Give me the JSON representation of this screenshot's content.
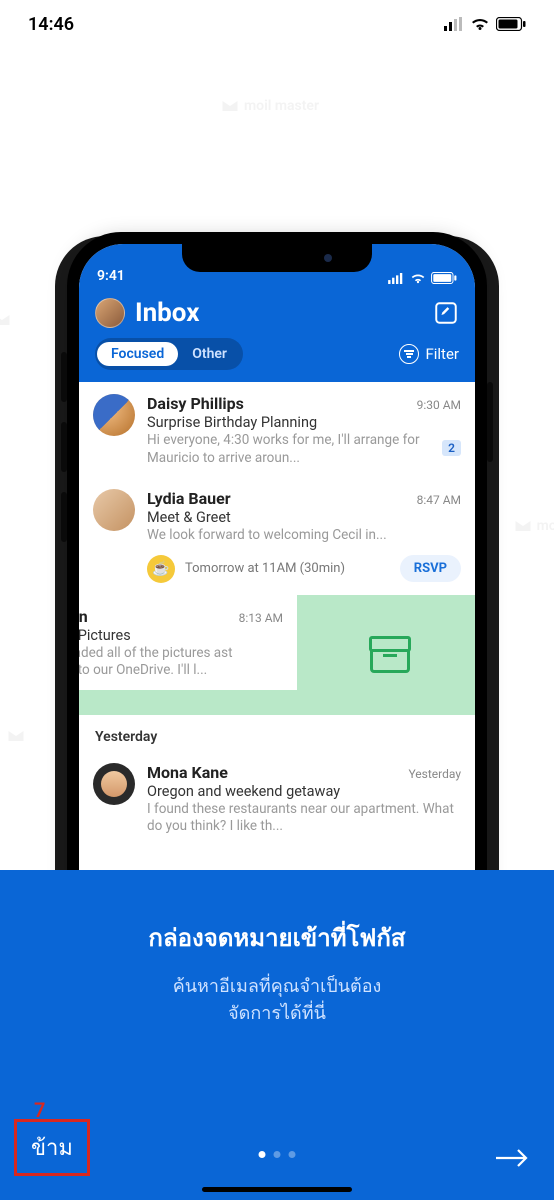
{
  "outer_status": {
    "time": "14:46"
  },
  "phone": {
    "status_time": "9:41",
    "title": "Inbox",
    "tabs": {
      "focused": "Focused",
      "other": "Other"
    },
    "filter_label": "Filter",
    "messages": [
      {
        "sender": "Daisy Phillips",
        "time": "9:30 AM",
        "subject": "Surprise Birthday Planning",
        "preview": "Hi everyone, 4:30 works for me, I'll arrange for Mauricio to arrive aroun...",
        "badge": "2"
      },
      {
        "sender": "Lydia Bauer",
        "time": "8:47 AM",
        "subject": "Meet & Greet",
        "preview": "We look forward to welcoming Cecil in...",
        "event_text": "Tomorrow at 11AM (30min)",
        "rsvp": "RSVP"
      },
      {
        "sender": "te Burton",
        "time": "8:13 AM",
        "subject": "Bonding Pictures",
        "preview": "cil, I uploaded all of the pictures ast weekend to our OneDrive. I'll l..."
      },
      {
        "sender": "Mona Kane",
        "time": "Yesterday",
        "subject": "Oregon and weekend getaway",
        "preview": "I found these restaurants near our apartment. What do you think? I like th..."
      }
    ],
    "section_yesterday": "Yesterday"
  },
  "panel": {
    "heading": "กล่องจดหมายเข้าที่โฟกัส",
    "subtitle_l1": "ค้นหาอีเมลที่คุณจำเป็นต้อง",
    "subtitle_l2": "จัดการได้ที่นี่",
    "skip": "ข้าม",
    "skip_annotation": "7",
    "page_index": 0,
    "page_count": 3
  }
}
